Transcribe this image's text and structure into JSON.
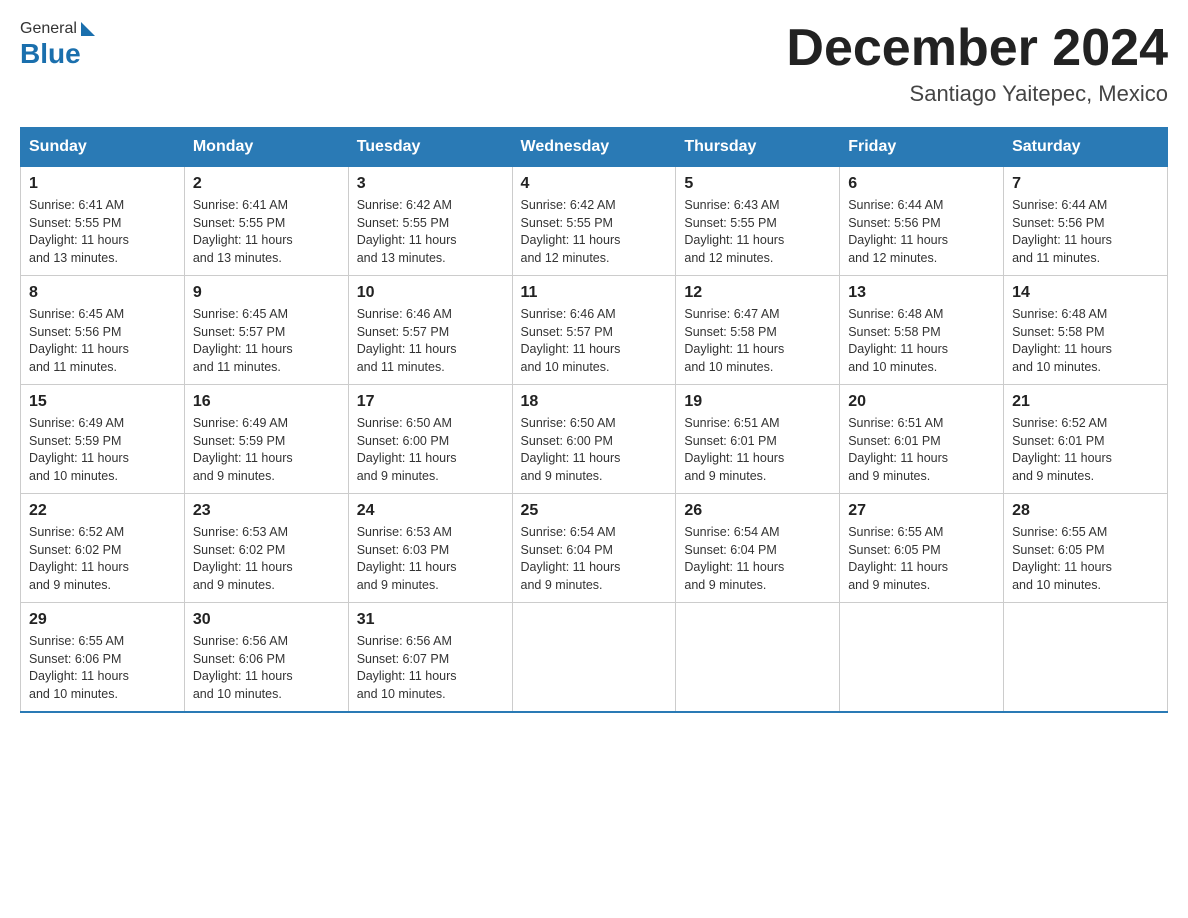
{
  "header": {
    "logo_general": "General",
    "logo_blue": "Blue",
    "month_title": "December 2024",
    "location": "Santiago Yaitepec, Mexico"
  },
  "weekdays": [
    "Sunday",
    "Monday",
    "Tuesday",
    "Wednesday",
    "Thursday",
    "Friday",
    "Saturday"
  ],
  "weeks": [
    [
      {
        "day": "1",
        "sunrise": "6:41 AM",
        "sunset": "5:55 PM",
        "daylight": "11 hours and 13 minutes."
      },
      {
        "day": "2",
        "sunrise": "6:41 AM",
        "sunset": "5:55 PM",
        "daylight": "11 hours and 13 minutes."
      },
      {
        "day": "3",
        "sunrise": "6:42 AM",
        "sunset": "5:55 PM",
        "daylight": "11 hours and 13 minutes."
      },
      {
        "day": "4",
        "sunrise": "6:42 AM",
        "sunset": "5:55 PM",
        "daylight": "11 hours and 12 minutes."
      },
      {
        "day": "5",
        "sunrise": "6:43 AM",
        "sunset": "5:55 PM",
        "daylight": "11 hours and 12 minutes."
      },
      {
        "day": "6",
        "sunrise": "6:44 AM",
        "sunset": "5:56 PM",
        "daylight": "11 hours and 12 minutes."
      },
      {
        "day": "7",
        "sunrise": "6:44 AM",
        "sunset": "5:56 PM",
        "daylight": "11 hours and 11 minutes."
      }
    ],
    [
      {
        "day": "8",
        "sunrise": "6:45 AM",
        "sunset": "5:56 PM",
        "daylight": "11 hours and 11 minutes."
      },
      {
        "day": "9",
        "sunrise": "6:45 AM",
        "sunset": "5:57 PM",
        "daylight": "11 hours and 11 minutes."
      },
      {
        "day": "10",
        "sunrise": "6:46 AM",
        "sunset": "5:57 PM",
        "daylight": "11 hours and 11 minutes."
      },
      {
        "day": "11",
        "sunrise": "6:46 AM",
        "sunset": "5:57 PM",
        "daylight": "11 hours and 10 minutes."
      },
      {
        "day": "12",
        "sunrise": "6:47 AM",
        "sunset": "5:58 PM",
        "daylight": "11 hours and 10 minutes."
      },
      {
        "day": "13",
        "sunrise": "6:48 AM",
        "sunset": "5:58 PM",
        "daylight": "11 hours and 10 minutes."
      },
      {
        "day": "14",
        "sunrise": "6:48 AM",
        "sunset": "5:58 PM",
        "daylight": "11 hours and 10 minutes."
      }
    ],
    [
      {
        "day": "15",
        "sunrise": "6:49 AM",
        "sunset": "5:59 PM",
        "daylight": "11 hours and 10 minutes."
      },
      {
        "day": "16",
        "sunrise": "6:49 AM",
        "sunset": "5:59 PM",
        "daylight": "11 hours and 9 minutes."
      },
      {
        "day": "17",
        "sunrise": "6:50 AM",
        "sunset": "6:00 PM",
        "daylight": "11 hours and 9 minutes."
      },
      {
        "day": "18",
        "sunrise": "6:50 AM",
        "sunset": "6:00 PM",
        "daylight": "11 hours and 9 minutes."
      },
      {
        "day": "19",
        "sunrise": "6:51 AM",
        "sunset": "6:01 PM",
        "daylight": "11 hours and 9 minutes."
      },
      {
        "day": "20",
        "sunrise": "6:51 AM",
        "sunset": "6:01 PM",
        "daylight": "11 hours and 9 minutes."
      },
      {
        "day": "21",
        "sunrise": "6:52 AM",
        "sunset": "6:01 PM",
        "daylight": "11 hours and 9 minutes."
      }
    ],
    [
      {
        "day": "22",
        "sunrise": "6:52 AM",
        "sunset": "6:02 PM",
        "daylight": "11 hours and 9 minutes."
      },
      {
        "day": "23",
        "sunrise": "6:53 AM",
        "sunset": "6:02 PM",
        "daylight": "11 hours and 9 minutes."
      },
      {
        "day": "24",
        "sunrise": "6:53 AM",
        "sunset": "6:03 PM",
        "daylight": "11 hours and 9 minutes."
      },
      {
        "day": "25",
        "sunrise": "6:54 AM",
        "sunset": "6:04 PM",
        "daylight": "11 hours and 9 minutes."
      },
      {
        "day": "26",
        "sunrise": "6:54 AM",
        "sunset": "6:04 PM",
        "daylight": "11 hours and 9 minutes."
      },
      {
        "day": "27",
        "sunrise": "6:55 AM",
        "sunset": "6:05 PM",
        "daylight": "11 hours and 9 minutes."
      },
      {
        "day": "28",
        "sunrise": "6:55 AM",
        "sunset": "6:05 PM",
        "daylight": "11 hours and 10 minutes."
      }
    ],
    [
      {
        "day": "29",
        "sunrise": "6:55 AM",
        "sunset": "6:06 PM",
        "daylight": "11 hours and 10 minutes."
      },
      {
        "day": "30",
        "sunrise": "6:56 AM",
        "sunset": "6:06 PM",
        "daylight": "11 hours and 10 minutes."
      },
      {
        "day": "31",
        "sunrise": "6:56 AM",
        "sunset": "6:07 PM",
        "daylight": "11 hours and 10 minutes."
      },
      null,
      null,
      null,
      null
    ]
  ],
  "labels": {
    "sunrise": "Sunrise:",
    "sunset": "Sunset:",
    "daylight": "Daylight:"
  }
}
